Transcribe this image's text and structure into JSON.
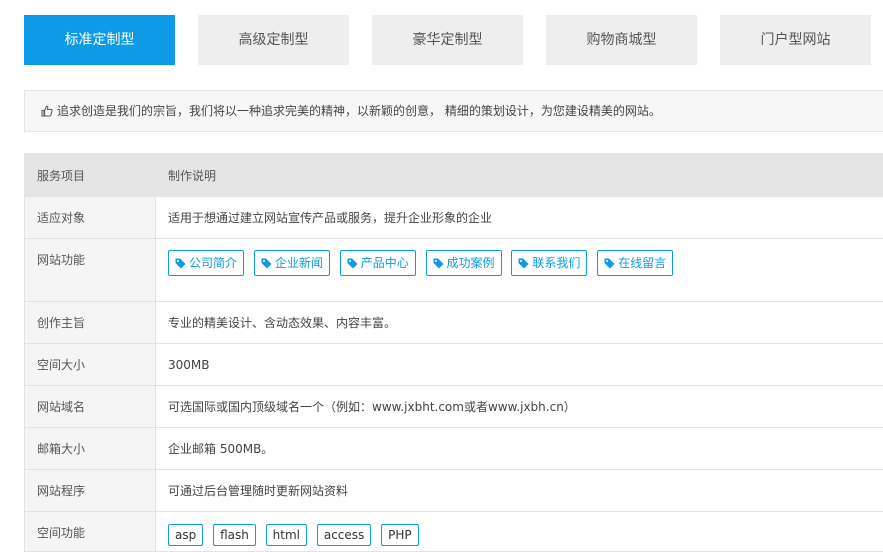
{
  "tabs": [
    "标准定制型",
    "高级定制型",
    "豪华定制型",
    "购物商城型",
    "门户型网站"
  ],
  "slogan": "追求创造是我们的宗旨，我们将以一种追求完美的精神，以新颖的创意， 精细的策划设计，为您建设精美的网站。",
  "table": {
    "header": {
      "label": "服务项目",
      "value": "制作说明"
    },
    "rows": {
      "target": {
        "label": "适应对象",
        "value": "适用于想通过建立网站宣传产品或服务，提升企业形象的企业"
      },
      "features": {
        "label": "网站功能",
        "items": [
          "公司简介",
          "企业新闻",
          "产品中心",
          "成功案例",
          "联系我们",
          "在线留言"
        ]
      },
      "theme": {
        "label": "创作主旨",
        "value": "专业的精美设计、含动态效果、内容丰富。"
      },
      "space": {
        "label": "空间大小",
        "value": "300MB"
      },
      "domain": {
        "label": "网站域名",
        "value": "可选国际或国内顶级域名一个（例如：www.jxbht.com或者www.jxbh.cn）"
      },
      "mailbox": {
        "label": "邮箱大小",
        "value": "企业邮箱 500MB。"
      },
      "program": {
        "label": "网站程序",
        "value": "可通过后台管理随时更新网站资料"
      },
      "space_features": {
        "label": "空间功能",
        "items": [
          "asp",
          "flash",
          "html",
          "access",
          "PHP"
        ]
      }
    }
  },
  "colors": {
    "accent": "#0e9be6",
    "tab_bg": "#eeeeee",
    "header_bg": "#e5e5e5"
  },
  "icons": {
    "slogan": "thumbs-up-icon",
    "feature": "tag-icon"
  }
}
